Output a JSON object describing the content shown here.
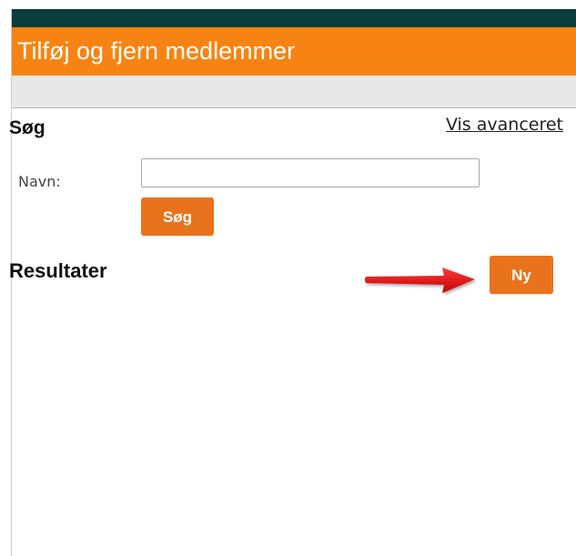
{
  "header": {
    "title": "Tilføj og fjern medlemmer"
  },
  "search": {
    "title": "Søg",
    "advanced_link": "Vis avanceret",
    "name_label": "Navn:",
    "name_value": "",
    "name_placeholder": "",
    "search_button": "Søg"
  },
  "results": {
    "title": "Resultater",
    "new_button": "Ny"
  },
  "colors": {
    "topbar": "#0b3d3a",
    "titlebar": "#f78412",
    "button": "#e8731c",
    "arrow": "#e01010"
  },
  "annotation": {
    "icon": "red-arrow-right-icon"
  }
}
